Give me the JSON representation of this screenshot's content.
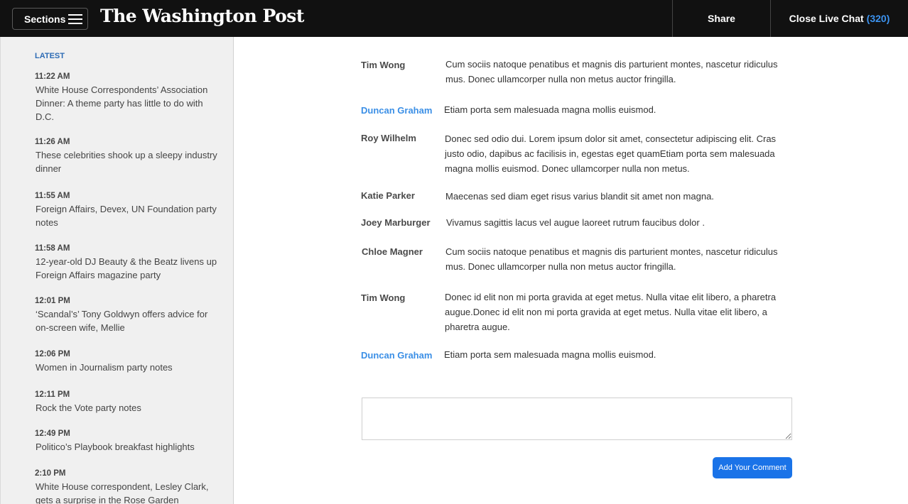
{
  "header": {
    "sections_label": "Sections",
    "logo_text": "The Washington Post",
    "share_label": "Share",
    "close_chat_label": "Close Live Chat",
    "chat_count": "(320)"
  },
  "sidebar": {
    "heading": "LATEST",
    "items": [
      {
        "time": "11:22 AM",
        "title": "White House Correspondents’ Association Dinner: A theme party has little to do with D.C."
      },
      {
        "time": "11:26 AM",
        "title": "These celebrities shook up a sleepy industry dinner"
      },
      {
        "time": "11:55 AM",
        "title": "Foreign Affairs, Devex, UN Foundation party notes"
      },
      {
        "time": "11:58 AM",
        "title": "12-year-old DJ Beauty & the Beatz livens up Foreign Affairs magazine party"
      },
      {
        "time": "12:01 PM",
        "title": "‘Scandal’s’ Tony Goldwyn offers advice for on-screen wife, Mellie"
      },
      {
        "time": "12:06 PM",
        "title": "Women in Journalism party notes"
      },
      {
        "time": "12:11 PM",
        "title": "Rock the Vote party notes"
      },
      {
        "time": "12:49 PM",
        "title": "Politico’s Playbook breakfast highlights"
      },
      {
        "time": "2:10 PM",
        "title": "White House correspondent, Lesley Clark, gets a surprise in the Rose Garden"
      }
    ]
  },
  "chat": {
    "messages": [
      {
        "author": "Tim Wong",
        "text": "Cum sociis natoque penatibus et magnis dis parturient montes, nascetur ridiculus mus. Donec ullamcorper nulla non metus auctor fringilla."
      },
      {
        "author": "Duncan Graham",
        "text": "Etiam porta sem malesuada magna mollis euismod."
      },
      {
        "author": "Roy Wilhelm",
        "text": "Donec sed odio dui. Lorem ipsum dolor sit amet, consectetur adipiscing elit. Cras justo odio, dapibus ac facilisis in, egestas eget quamEtiam porta sem malesuada magna mollis euismod. Donec ullamcorper nulla non metus."
      },
      {
        "author": "Katie Parker",
        "text": "Maecenas sed diam eget risus varius blandit sit amet non magna."
      },
      {
        "author": "Joey Marburger",
        "text": "Vivamus sagittis lacus vel augue laoreet rutrum faucibus dolor ."
      },
      {
        "author": "Chloe Magner",
        "text": "Cum sociis natoque penatibus et magnis dis parturient montes, nascetur ridiculus mus. Donec ullamcorper nulla non metus auctor fringilla."
      },
      {
        "author": "Tim Wong",
        "text": "Donec id elit non mi porta gravida at eget metus. Nulla vitae elit libero, a pharetra augue.Donec id elit non mi porta gravida at eget metus. Nulla vitae elit libero, a pharetra augue."
      },
      {
        "author": "Duncan Graham",
        "text": "Etiam porta sem malesuada magna mollis euismod."
      }
    ],
    "add_comment_label": "Add Your Comment"
  },
  "colors": {
    "topbar": "#111111",
    "accent_blue": "#3b8fe6",
    "button_blue": "#1a73e8",
    "sidebar_bg": "#f0f0f0"
  },
  "icons": [
    "hamburger-menu-icon"
  ]
}
